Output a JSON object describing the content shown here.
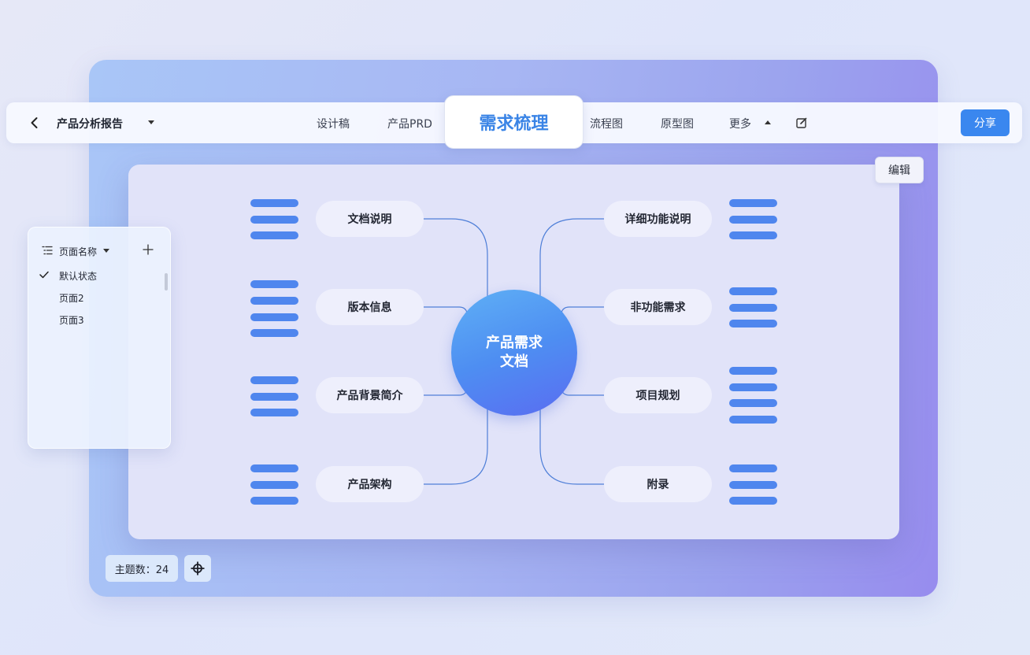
{
  "toolbar": {
    "doc_title": "产品分析报告",
    "nav_items": [
      "设计稿",
      "产品PRD",
      "流程图",
      "原型图",
      "更多"
    ],
    "active_tab": "需求梳理",
    "share_label": "分享"
  },
  "canvas": {
    "edit_label": "编辑",
    "center_line1": "产品需求",
    "center_line2": "文档",
    "left_branches": [
      "文档说明",
      "版本信息",
      "产品背景简介",
      "产品架构"
    ],
    "right_branches": [
      "详细功能说明",
      "非功能需求",
      "项目规划",
      "附录"
    ]
  },
  "pages_panel": {
    "title": "页面名称",
    "pages": [
      "默认状态",
      "页面2",
      "页面3"
    ],
    "selected_page": "默认状态"
  },
  "status": {
    "topic_count_label": "主题数：24"
  },
  "colors": {
    "accent": "#3a87ef",
    "active_tab_text": "#3a84e6",
    "bar": "#4f86ee",
    "link": "#4f7fd8"
  },
  "icons": {
    "back": "chevron-left-icon",
    "edit": "edit-square-icon",
    "list": "list-icon",
    "add": "plus-icon",
    "check": "check-icon",
    "locate": "crosshair-icon"
  }
}
